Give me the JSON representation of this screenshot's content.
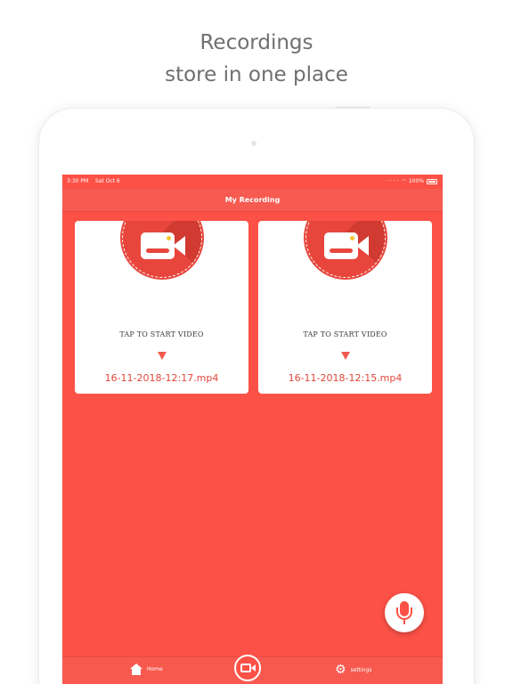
{
  "promo": {
    "line1": "Recordings",
    "line2": "store in one place"
  },
  "status_bar": {
    "time": "3:30 PM",
    "date": "Sat Oct 6",
    "battery": "100%"
  },
  "nav": {
    "title": "My Recording"
  },
  "recordings": [
    {
      "action_label": "TAP TO START VIDEO",
      "file_name": "16-11-2018-12:17.mp4"
    },
    {
      "action_label": "TAP TO START VIDEO",
      "file_name": "16-11-2018-12:15.mp4"
    }
  ],
  "tabs": {
    "home_label": "Home",
    "settings_label": "settings"
  },
  "icons": {
    "badge": "video-camera-icon",
    "fab": "microphone-icon",
    "home": "home-icon",
    "settings": "gear-icon",
    "record": "record-video-icon"
  },
  "colors": {
    "accent": "#fc5146",
    "badge": "#e8463c",
    "highlight": "#f4c431"
  }
}
